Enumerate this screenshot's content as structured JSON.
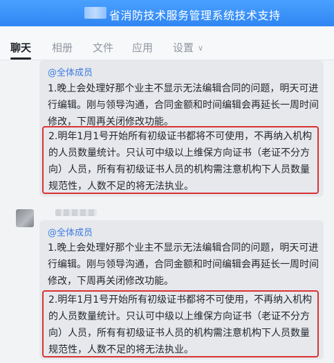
{
  "window": {
    "title": "省消防技术服务管理系统技术支持"
  },
  "tabs": [
    {
      "label": "聊天"
    },
    {
      "label": "相册"
    },
    {
      "label": "文件"
    },
    {
      "label": "应用"
    },
    {
      "label": "设置"
    }
  ],
  "messages": [
    {
      "mention": "@全体成员",
      "para1": "1.晚上会处理好那个业主不显示无法编辑合同的问题，明天可进行编辑。刚与领导沟通，合同金额和时间编辑会再延长一周时间修改，下周再关闭修改功能。",
      "para2": "2.明年1月1号开始所有初级证书都将不可使用，不再纳入机构的人员数量统计。只认可中级以上维保方向证书（老证不分方向）人员，所有有初级证书人员的机构需注意机构下人员数量规范性，人数不足的将无法执业。"
    },
    {
      "mention": "@全体成员",
      "para1": "1.晚上会处理好那个业主不显示无法编辑合同的问题，明天可进行编辑。刚与领导沟通，合同金额和时间编辑会再延长一周时间修改，下周再关闭修改功能。",
      "para2": "2.明年1月1号开始所有初级证书都将不可使用，不再纳入机构的人员数量统计。只认可中级以上维保方向证书（老证不分方向）人员，所有有初级证书人员的机构需注意机构下人员数量规范性，人数不足的将无法执业。"
    }
  ],
  "colors": {
    "accent": "#2f86f2",
    "highlight_border": "#d93131",
    "mention": "#3b7be0"
  }
}
